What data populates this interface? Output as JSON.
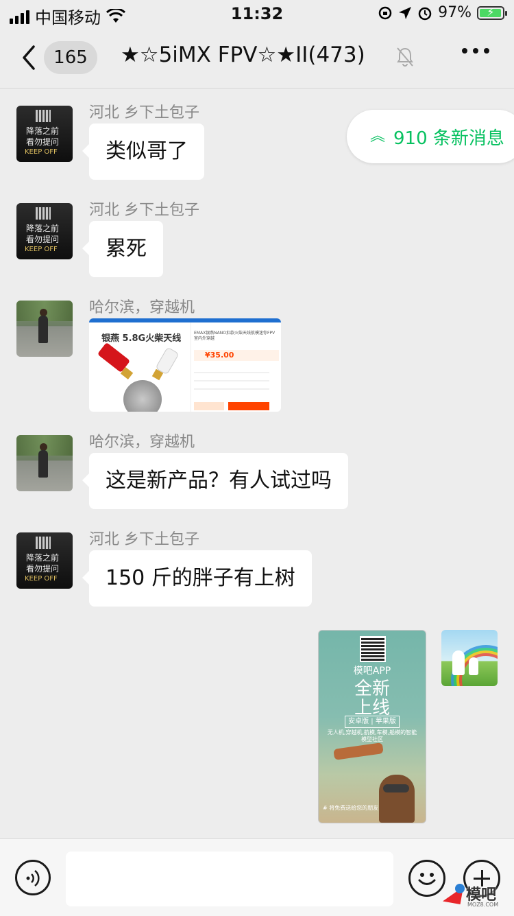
{
  "status_bar": {
    "carrier": "中国移动",
    "time": "11:32",
    "battery": "97%",
    "battery_level": 0.97
  },
  "nav": {
    "unread_count": "165",
    "title": "★☆5iMX FPV☆★II(473)",
    "muted": true
  },
  "new_messages_pill": "910 条新消息",
  "messages": [
    {
      "sender": "河北 乡下土包子",
      "text": "类似哥了",
      "avatar": "black-tshirt-avatar",
      "avatar_text": [
        "降落之前",
        "看勿提问",
        "KEEP OFF"
      ]
    },
    {
      "sender": "河北 乡下土包子",
      "text": "累死",
      "avatar": "black-tshirt-avatar",
      "avatar_text": [
        "降落之前",
        "看勿提问",
        "KEEP OFF"
      ]
    },
    {
      "sender": "哈尔滨，穿越机",
      "type": "image",
      "avatar": "walking-person-avatar",
      "image": {
        "title": "银燕 5.8G火柴天线",
        "price": "¥35.00",
        "desc": "EMAX银燕NANO扣款火柴天线航模迷你FPV室内外穿越"
      }
    },
    {
      "sender": "哈尔滨，穿越机",
      "text": "这是新产品？有人试过吗",
      "avatar": "walking-person-avatar"
    },
    {
      "sender": "河北 乡下土包子",
      "text": "150 斤的胖子有上树",
      "avatar": "black-tshirt-avatar",
      "avatar_text": [
        "降落之前",
        "看勿提问",
        "KEEP OFF"
      ]
    }
  ],
  "outgoing": {
    "poster": {
      "app": "模吧APP",
      "line1": "全新",
      "line2": "上线",
      "versions": "安卓版 | 苹果版",
      "tagline": "无人机,穿越机,航模,车模,船模的智能模型社区",
      "footer": "# 将免费送给您的朋友"
    },
    "avatar": "rainbow-avatar"
  },
  "input_bar": {
    "placeholder": ""
  },
  "watermark": {
    "text": "模吧",
    "url": "MOZ8.COM"
  }
}
